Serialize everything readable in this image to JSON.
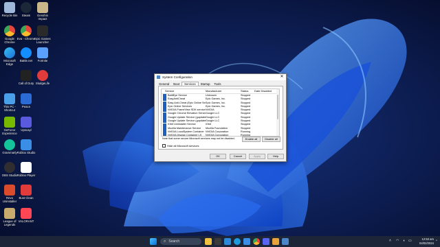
{
  "desktop": {
    "icons": [
      {
        "label": "Recycle Bin",
        "color": "#9fb7d9",
        "icon": "recycle-bin-icon"
      },
      {
        "label": "Steam",
        "color": "#1b2838",
        "icon": "steam-icon"
      },
      {
        "label": "Genshin Impact",
        "color": "#c9b68a",
        "icon": "genshin-icon"
      },
      {
        "label": "Google Chrome",
        "color": "#e8453c",
        "icon": "chrome-icon"
      },
      {
        "label": "Eva - Chrome",
        "color": "#e8a33c",
        "icon": "chrome-icon"
      },
      {
        "label": "Epic Games Launcher",
        "color": "#2a2a2a",
        "icon": "epic-games-icon"
      },
      {
        "label": "Microsoft Edge",
        "color": "#1f9bd9",
        "icon": "edge-icon"
      },
      {
        "label": "Battle.net",
        "color": "#148eff",
        "icon": "battlenet-icon"
      },
      {
        "label": "Fortnite",
        "color": "#5aa0ff",
        "icon": "fortnite-icon"
      },
      {
        "label": "Call of Duty",
        "color": "#222222",
        "icon": "call-of-duty-icon"
      },
      {
        "label": "SludgeLife",
        "color": "#e03c3c",
        "icon": "sludgelife-icon"
      },
      {
        "label": "This PC - Shortcut",
        "color": "#4aa0e8",
        "icon": "this-pc-icon"
      },
      {
        "label": "Peace",
        "color": "#2a6bd6",
        "icon": "peace-icon"
      },
      {
        "label": "GeForce Experience",
        "color": "#76b900",
        "icon": "geforce-icon"
      },
      {
        "label": "Upscayl",
        "color": "#5a5adf",
        "icon": "upscayl-icon"
      },
      {
        "label": "Grammarly",
        "color": "#15c39a",
        "icon": "grammarly-icon"
      },
      {
        "label": "Roblox Studio",
        "color": "#3a8ee6",
        "icon": "roblox-studio-icon"
      },
      {
        "label": "OBS Studio",
        "color": "#302e31",
        "icon": "obs-icon"
      },
      {
        "label": "Roblox Player",
        "color": "#ffffff",
        "icon": "roblox-icon"
      },
      {
        "label": "Revo Uninstaller",
        "color": "#d94b2b",
        "icon": "revo-icon"
      },
      {
        "label": "Bust Clean",
        "color": "#e23b3b",
        "icon": "bust-clean-icon"
      },
      {
        "label": "League of Legends",
        "color": "#c8aa6e",
        "icon": "league-icon"
      },
      {
        "label": "VALORANT",
        "color": "#ff4655",
        "icon": "valorant-icon"
      }
    ]
  },
  "dialog": {
    "title": "System Configuration",
    "tabs": [
      "General",
      "Boot",
      "Services",
      "Startup",
      "Tools"
    ],
    "active_tab": "Services",
    "columns": {
      "service": "Service",
      "manufacturer": "Manufacturer",
      "status": "Status",
      "date_disabled": "Date Disabled"
    },
    "rows": [
      {
        "service": "BattlEye Service",
        "manufacturer": "Unknown",
        "status": "Stopped"
      },
      {
        "service": "EasyAntiCheat",
        "manufacturer": "Epic Games, Inc.",
        "status": "Stopped"
      },
      {
        "service": "Easy Anti-Cheat (Epic Online Se...",
        "manufacturer": "Epic Games, Inc.",
        "status": "Stopped"
      },
      {
        "service": "Epic Online Services",
        "manufacturer": "Epic Games, Inc.",
        "status": "Stopped"
      },
      {
        "service": "NVIDIA FrameView SDK service",
        "manufacturer": "NVIDIA",
        "status": "Stopped"
      },
      {
        "service": "Google Chrome Elevation Servic...",
        "manufacturer": "Google LLC",
        "status": "Stopped"
      },
      {
        "service": "Google Update Service (gupdate)",
        "manufacturer": "Google LLC",
        "status": "Stopped"
      },
      {
        "service": "Google Update Service (gupdatem)",
        "manufacturer": "Google LLC",
        "status": "Stopped"
      },
      {
        "service": "IObit Uninstaller Service",
        "manufacturer": "IObit",
        "status": "Stopped"
      },
      {
        "service": "Mozilla Maintenance Service",
        "manufacturer": "Mozilla Foundation",
        "status": "Stopped"
      },
      {
        "service": "NVIDIA LocalSystem Container",
        "manufacturer": "NVIDIA Corporation",
        "status": "Running"
      },
      {
        "service": "NVIDIA Display Container LS",
        "manufacturer": "NVIDIA Corporation",
        "status": "Running"
      }
    ],
    "note": "Note that some secure Microsoft services may not be disabled.",
    "enable_all": "Enable all",
    "disable_all": "Disable all",
    "hide_ms": "Hide all Microsoft services",
    "ok": "OK",
    "cancel": "Cancel",
    "apply": "Apply",
    "help": "Help"
  },
  "taskbar": {
    "search_placeholder": "Search",
    "time": "12:53 am",
    "date": "04/02/2024"
  }
}
